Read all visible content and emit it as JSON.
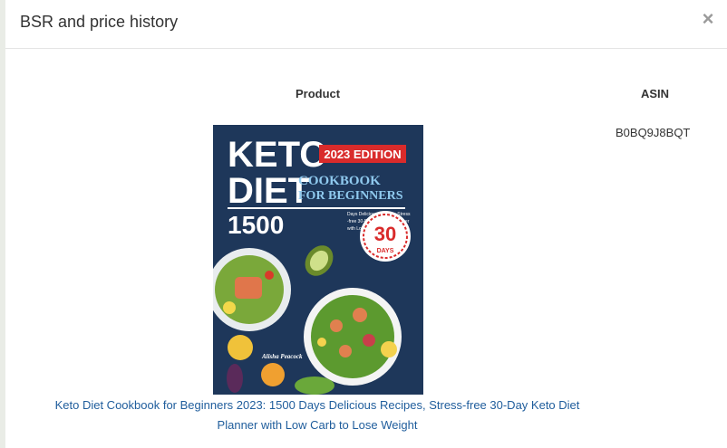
{
  "modal": {
    "title": "BSR and price history",
    "close_label": "×"
  },
  "table": {
    "headers": {
      "product": "Product",
      "asin": "ASIN"
    },
    "rows": [
      {
        "asin": "B0BQ9J8BQT",
        "product_title": "Keto Diet Cookbook for Beginners 2023: 1500 Days Delicious Recipes, Stress-free 30-Day Keto Diet Planner with Low Carb to Lose Weight",
        "cover": {
          "line1": "KETO",
          "line2": "DIET",
          "edition": "2023 EDITION",
          "cookbook": "COOKBOOK",
          "for_beginners": "FOR BEGINNERS",
          "big_number": "1500",
          "subtitle_lines": [
            "Days Delicious Recipes, Stress",
            "-free 30-Day Keto Diet Planner",
            "with Low Carb to Lose Weight"
          ],
          "badge_number": "30",
          "badge_word": "DAYS",
          "author": "Alisha Peacock"
        }
      }
    ]
  },
  "colors": {
    "link": "#1f5d9c",
    "cover_bg": "#1c3455",
    "edition_red": "#d92b2b",
    "cookbook_blue": "#8fc9ee"
  }
}
